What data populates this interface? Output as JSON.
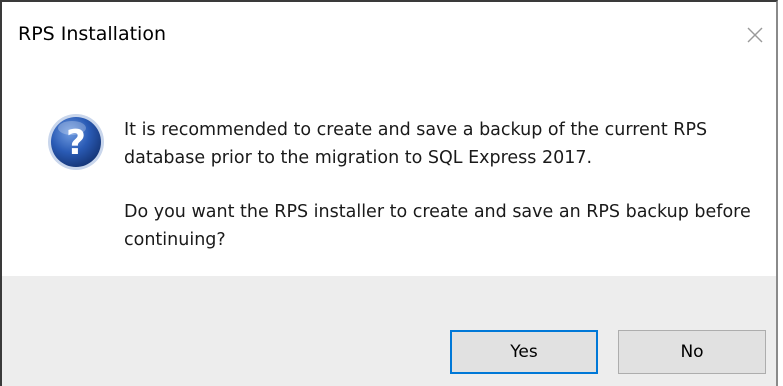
{
  "window": {
    "title": "RPS Installation"
  },
  "dialog": {
    "icon": "question-icon",
    "message_line1": "It is recommended to create and save a backup of the current RPS database prior to the migration to SQL Express 2017.",
    "message_line2": "Do you want the RPS installer to create and save an RPS backup before continuing?"
  },
  "buttons": {
    "yes_label": "Yes",
    "no_label": "No"
  },
  "colors": {
    "icon_blue": "#1f4fa3",
    "footer_bg": "#ededed",
    "button_bg": "#e1e1e1",
    "default_border": "#0078d7"
  }
}
